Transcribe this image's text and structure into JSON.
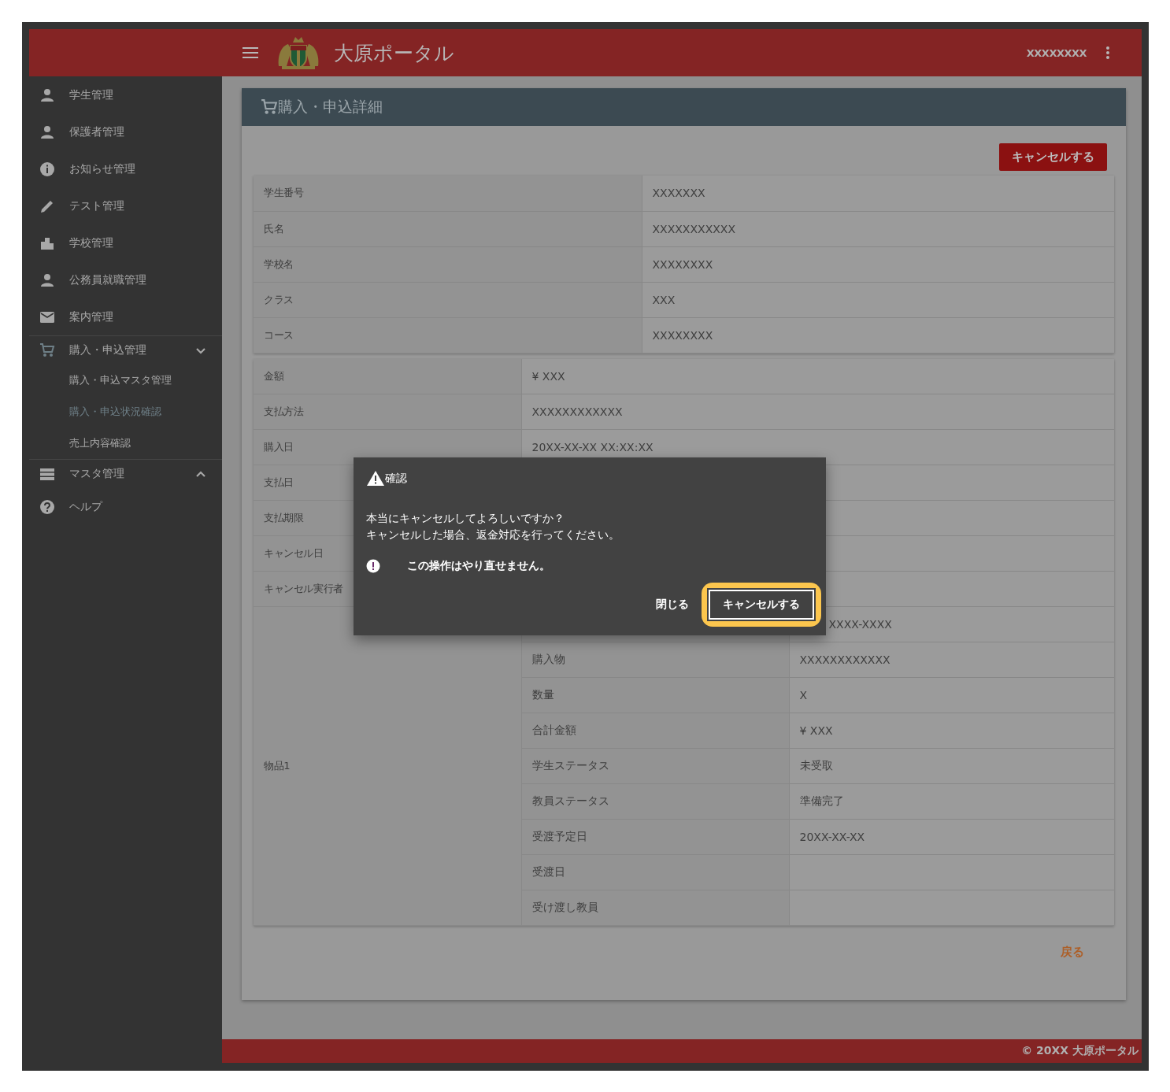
{
  "header": {
    "title": "大原ポータル",
    "user": "XXXXXXXX"
  },
  "sidebar": {
    "items": [
      {
        "label": "学生管理"
      },
      {
        "label": "保護者管理"
      },
      {
        "label": "お知らせ管理"
      },
      {
        "label": "テスト管理"
      },
      {
        "label": "学校管理"
      },
      {
        "label": "公務員就職管理"
      },
      {
        "label": "案内管理"
      },
      {
        "label": "購入・申込管理",
        "expanded": true,
        "children": [
          {
            "label": "購入・申込マスタ管理",
            "selected": false
          },
          {
            "label": "購入・申込状況確認",
            "selected": true
          },
          {
            "label": "売上内容確認",
            "selected": false
          }
        ]
      },
      {
        "label": "マスタ管理",
        "expanded": false
      },
      {
        "label": "ヘルプ"
      }
    ]
  },
  "page": {
    "title": "購入・申込詳細",
    "cancel_button": "キャンセルする",
    "back_link": "戻る"
  },
  "student_table": [
    {
      "label": "学生番号",
      "value": "XXXXXXX"
    },
    {
      "label": "氏名",
      "value": "XXXXXXXXXXX"
    },
    {
      "label": "学校名",
      "value": "XXXXXXXX"
    },
    {
      "label": "クラス",
      "value": "XXX"
    },
    {
      "label": "コース",
      "value": "XXXXXXXX"
    }
  ],
  "order_table": [
    {
      "label": "金額",
      "value": "¥ XXX"
    },
    {
      "label": "支払方法",
      "value": "XXXXXXXXXXXX"
    },
    {
      "label": "購入日",
      "value": "20XX-XX-XX XX:XX:XX"
    },
    {
      "label": "支払日"
    },
    {
      "label": "支払期限"
    },
    {
      "label": "キャンセル日"
    },
    {
      "label": "キャンセル実行者"
    }
  ],
  "items": [
    {
      "label": "物品1",
      "fields": [
        {
          "value": "XXXX-XXXX",
          "covered": true
        },
        {
          "label": "購入物",
          "value": "XXXXXXXXXXXX"
        },
        {
          "label": "数量",
          "value": "X"
        },
        {
          "label": "合計金額",
          "value": "¥ XXX"
        },
        {
          "label": "学生ステータス",
          "value": "未受取"
        },
        {
          "label": "教員ステータス",
          "value": "準備完了"
        },
        {
          "label": "受渡予定日",
          "value": "20XX-XX-XX"
        },
        {
          "label": "受渡日"
        },
        {
          "label": "受け渡し教員"
        }
      ]
    }
  ],
  "dialog": {
    "title": "確認",
    "message_lines": [
      "本当にキャンセルしてよろしいですか？",
      "キャンセルした場合、返金対応を行ってください。"
    ],
    "warning": "この操作はやり直せません。",
    "close_button": "閉じる",
    "confirm_button": {
      "label": "キャンセルする",
      "highlighted": true
    }
  },
  "footer": "© 20XX 大原ポータル"
}
